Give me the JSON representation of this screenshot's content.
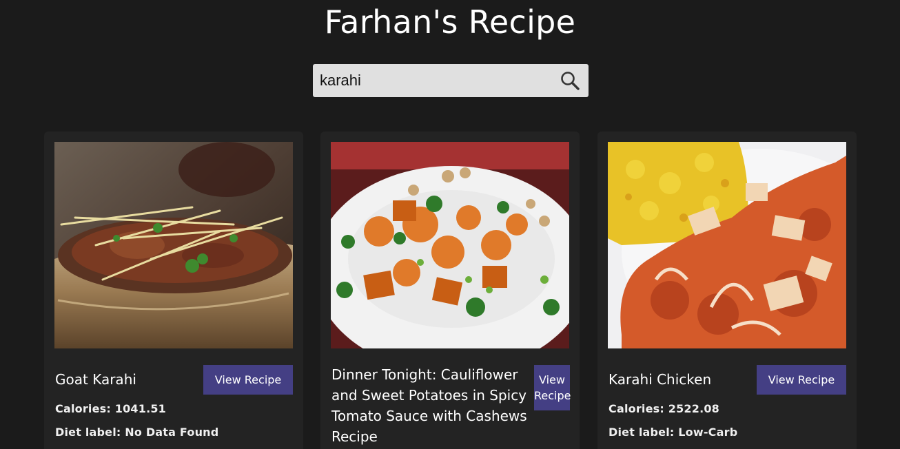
{
  "header": {
    "title": "Farhan's Recipe"
  },
  "search": {
    "value": "karahi",
    "icon": "search-icon"
  },
  "recipes": [
    {
      "title": "Goat Karahi",
      "button": "View Recipe",
      "calories": "Calories: 1041.51",
      "diet": "Diet label: No Data Found"
    },
    {
      "title": "Dinner Tonight: Cauliflower and Sweet Potatoes in Spicy Tomato Sauce with Cashews Recipe",
      "button": "View Recipe"
    },
    {
      "title": "Karahi Chicken",
      "button": "View Recipe",
      "calories": "Calories: 2522.08",
      "diet": "Diet label: Low-Carb"
    }
  ],
  "colors": {
    "background": "#1b1b1b",
    "card": "#232323",
    "button": "#443f84",
    "search_bg": "#e0e0e0"
  }
}
